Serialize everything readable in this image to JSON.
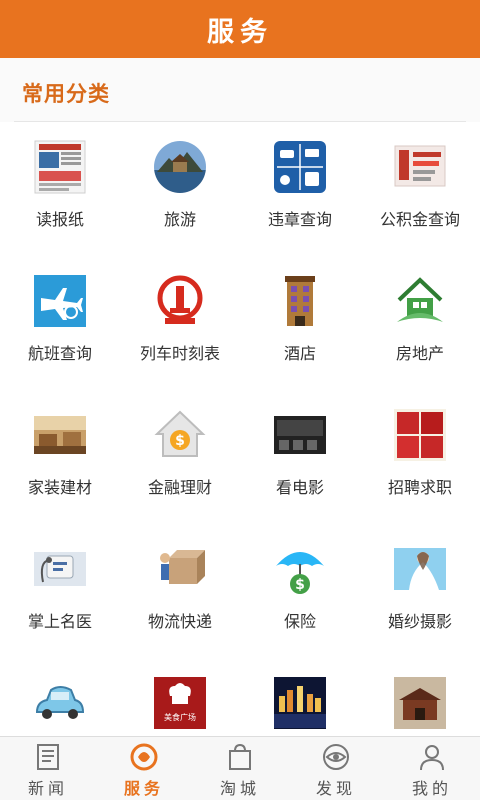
{
  "header": {
    "title": "服务"
  },
  "section": {
    "title": "常用分类"
  },
  "categories": [
    {
      "label": "读报纸",
      "icon": "newspaper-icon"
    },
    {
      "label": "旅游",
      "icon": "travel-icon"
    },
    {
      "label": "违章查询",
      "icon": "traffic-violation-icon"
    },
    {
      "label": "公积金查询",
      "icon": "housing-fund-icon"
    },
    {
      "label": "航班查询",
      "icon": "airplane-icon"
    },
    {
      "label": "列车时刻表",
      "icon": "railway-icon"
    },
    {
      "label": "酒店",
      "icon": "hotel-icon"
    },
    {
      "label": "房地产",
      "icon": "house-icon"
    },
    {
      "label": "家装建材",
      "icon": "home-decor-icon"
    },
    {
      "label": "金融理财",
      "icon": "finance-icon"
    },
    {
      "label": "看电影",
      "icon": "movie-icon"
    },
    {
      "label": "招聘求职",
      "icon": "recruitment-icon"
    },
    {
      "label": "掌上名医",
      "icon": "doctor-icon"
    },
    {
      "label": "物流快递",
      "icon": "delivery-icon"
    },
    {
      "label": "保险",
      "icon": "insurance-icon"
    },
    {
      "label": "婚纱摄影",
      "icon": "wedding-photo-icon"
    },
    {
      "label": "",
      "icon": "car-icon"
    },
    {
      "label": "",
      "icon": "food-plaza-icon",
      "text": "美食广场"
    },
    {
      "label": "",
      "icon": "night-city-icon"
    },
    {
      "label": "",
      "icon": "landmark-icon"
    }
  ],
  "tabs": [
    {
      "label": "新闻",
      "icon": "news-icon",
      "active": false
    },
    {
      "label": "服务",
      "icon": "service-icon",
      "active": true
    },
    {
      "label": "淘城",
      "icon": "shopping-bag-icon",
      "active": false
    },
    {
      "label": "发现",
      "icon": "discover-icon",
      "active": false
    },
    {
      "label": "我的",
      "icon": "profile-icon",
      "active": false
    }
  ],
  "colors": {
    "brand": "#e8731f",
    "section_title": "#d86a1a"
  }
}
